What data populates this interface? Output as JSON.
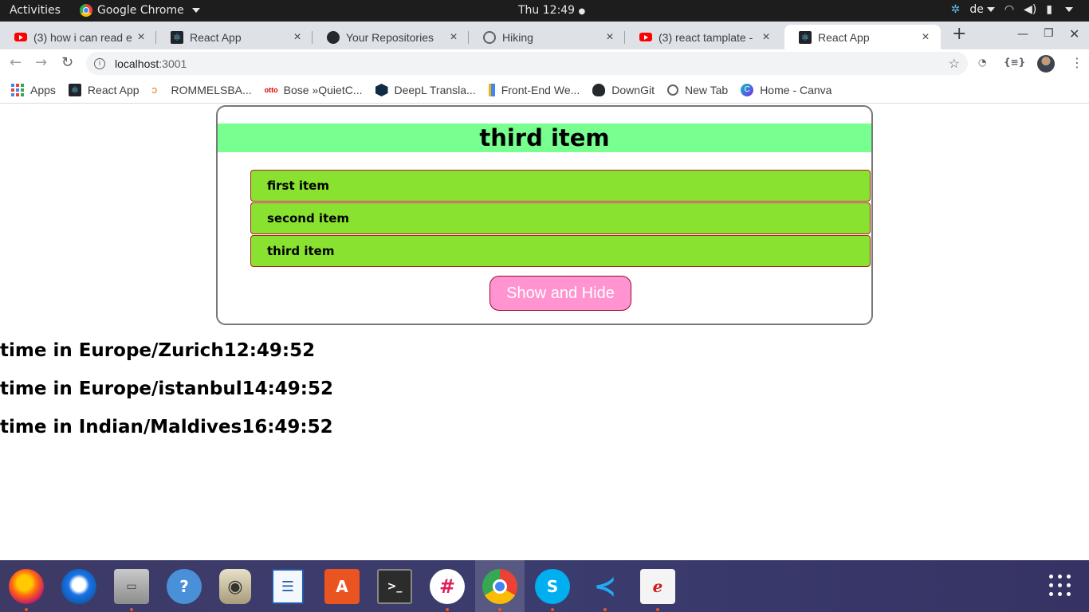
{
  "system": {
    "activities": "Activities",
    "app_name": "Google Chrome",
    "clock": "Thu 12:49",
    "keyboard_layout": "de"
  },
  "tabs": [
    {
      "label": "(3) how i can read e",
      "icon": "youtube-icon"
    },
    {
      "label": "React App",
      "icon": "react-icon"
    },
    {
      "label": "Your Repositories",
      "icon": "github-icon"
    },
    {
      "label": "Hiking",
      "icon": "globe-icon"
    },
    {
      "label": "(3) react tamplate -",
      "icon": "youtube-icon"
    },
    {
      "label": "React App",
      "icon": "react-icon",
      "active": true
    }
  ],
  "address_bar": {
    "host": "localhost",
    "port": ":3001"
  },
  "bookmarks": [
    {
      "label": "Apps",
      "icon": "apps-grid-icon"
    },
    {
      "label": "React App",
      "icon": "react-icon"
    },
    {
      "label": "ROMMELSBA...",
      "icon": "rommelsbacher-icon"
    },
    {
      "label": "Bose »QuietC...",
      "icon": "otto-icon"
    },
    {
      "label": "DeepL Transla...",
      "icon": "deepl-icon"
    },
    {
      "label": "Front-End We...",
      "icon": "frontend-icon"
    },
    {
      "label": "DownGit",
      "icon": "downgit-icon"
    },
    {
      "label": "New Tab",
      "icon": "globe-icon"
    },
    {
      "label": "Home - Canva",
      "icon": "canva-icon"
    }
  ],
  "page": {
    "selected_title": "third item",
    "items": [
      "first item",
      "second item",
      "third item"
    ],
    "toggle_button": "Show and Hide",
    "times": [
      "time in Europe/Zurich12:49:52",
      "time in Europe/istanbul14:49:52",
      "time in Indian/Maldives16:49:52"
    ]
  },
  "colors": {
    "title_bg": "#77ff8f",
    "item_bg": "#89e22f",
    "item_border": "#b02020",
    "button_bg": "#ff94d0"
  },
  "dock": [
    {
      "name": "firefox-icon",
      "running": true
    },
    {
      "name": "thunderbird-icon",
      "running": false
    },
    {
      "name": "files-icon",
      "running": true
    },
    {
      "name": "help-icon",
      "running": false
    },
    {
      "name": "rhythmbox-icon",
      "running": false
    },
    {
      "name": "writer-icon",
      "running": false
    },
    {
      "name": "software-icon",
      "running": false
    },
    {
      "name": "terminal-icon",
      "running": false
    },
    {
      "name": "slack-icon",
      "running": true
    },
    {
      "name": "chrome-icon",
      "running": true
    },
    {
      "name": "skype-icon",
      "running": true
    },
    {
      "name": "vscode-icon",
      "running": true
    },
    {
      "name": "evince-icon",
      "running": true
    }
  ]
}
